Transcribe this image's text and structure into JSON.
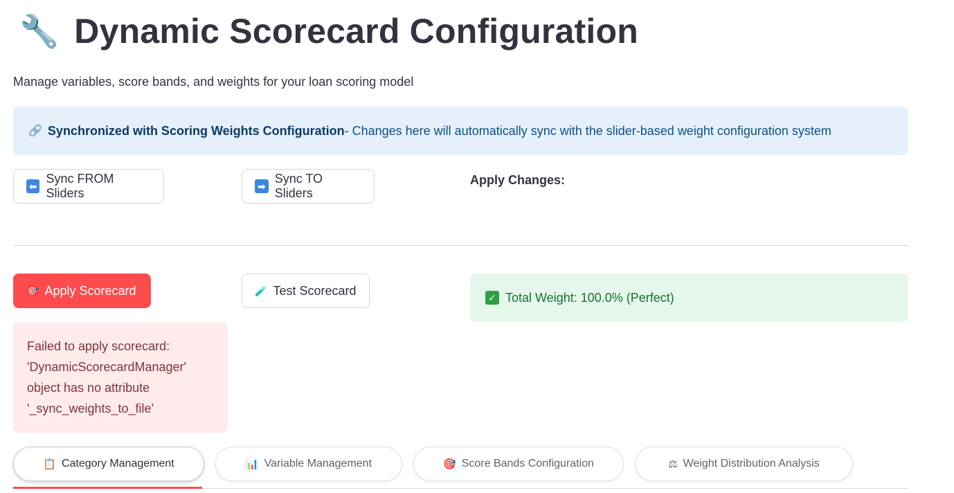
{
  "header": {
    "icon": "wrench-icon",
    "title": "Dynamic Scorecard Configuration",
    "subtitle": "Manage variables, score bands, and weights for your loan scoring model"
  },
  "info": {
    "icon": "link-icon",
    "strong": "Synchronized with Scoring Weights Configuration",
    "text": " - Changes here will automatically sync with the slider-based weight configuration system"
  },
  "sync": {
    "from_label": "Sync FROM Sliders",
    "to_label": "Sync TO Sliders"
  },
  "apply_changes_label": "Apply Changes:",
  "actions": {
    "apply_label": "Apply Scorecard",
    "test_label": "Test Scorecard"
  },
  "status": {
    "total_weight": "Total Weight: 100.0% (Perfect)"
  },
  "error": {
    "message": "Failed to apply scorecard: 'DynamicScorecardManager' object has no attribute '_sync_weights_to_file'"
  },
  "tabs": [
    {
      "label": "Category Management",
      "icon": "clipboard-icon"
    },
    {
      "label": "Variable Management",
      "icon": "bar-chart-icon"
    },
    {
      "label": "Score Bands Configuration",
      "icon": "target-icon"
    },
    {
      "label": "Weight Distribution Analysis",
      "icon": "scale-icon"
    }
  ],
  "colors": {
    "primary": "#ff4b4b",
    "info_bg": "#e6f0fb",
    "success_bg": "#e5f7ea",
    "error_bg": "#ffebec"
  }
}
